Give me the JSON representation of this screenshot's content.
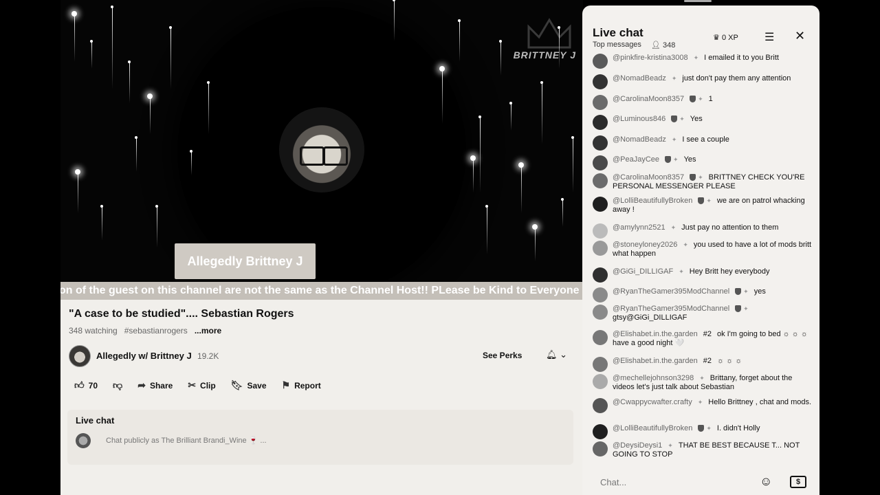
{
  "video": {
    "name_plate": "Allegedly Brittney J",
    "watermark": "BRITTNEY J",
    "ticker": "on of the guest on this channel are not the same as the Channel Host!! PLease be Kind to Everyone"
  },
  "details": {
    "title": "\"A case to be studied\"....  Sebastian Rogers",
    "watching": "348 watching",
    "hashtag": "#sebastianrogers",
    "more": "...more",
    "channel_name": "Allegedly w/ Brittney J",
    "subscribers": "19.2K",
    "see_perks": "See Perks",
    "bell_icon": "bell-icon",
    "actions": {
      "likes": "70",
      "share": "Share",
      "clip": "Clip",
      "save": "Save",
      "report": "Report"
    },
    "live_chat_panel": {
      "title": "Live chat",
      "input_placeholder": "Chat publicly as The Brilliant Brandi_Wine 🍷 ..."
    }
  },
  "chat": {
    "title": "Live chat",
    "subtitle": "Top messages",
    "viewers": "348",
    "xp": "0 XP",
    "input_placeholder": "Chat...",
    "messages": [
      {
        "author": "@pinkfire-kristina3008",
        "text": "I emailed it to you Britt",
        "badge": false
      },
      {
        "author": "@NomadBeadz",
        "text": "just don't pay them any attention",
        "badge": false
      },
      {
        "author": "@CarolinaMoon8357",
        "text": "1",
        "badge": true
      },
      {
        "author": "@Luminous846",
        "text": "Yes",
        "badge": true
      },
      {
        "author": "@NomadBeadz",
        "text": "I see a couple",
        "badge": false
      },
      {
        "author": "@PeaJayCee",
        "text": "Yes",
        "badge": true
      },
      {
        "author": "@CarolinaMoon8357",
        "text": "BRITTNEY CHECK YOU'RE PERSONAL MESSENGER PLEASE",
        "badge": true
      },
      {
        "author": "@LolliBeautifullyBroken",
        "text": "we are on patrol whacking away !",
        "badge": true
      },
      {
        "author": "@amylynn2521",
        "text": "Just pay no attention to them",
        "badge": false
      },
      {
        "author": "@stoneyloney2026",
        "text": "you used to have a lot of mods britt what happen",
        "badge": false
      },
      {
        "author": "@GiGi_DILLIGAF",
        "text": "Hey Britt hey everybody",
        "badge": false
      },
      {
        "author": "@RyanTheGamer395ModChannel",
        "text": "yes",
        "badge": true
      },
      {
        "author": "@RyanTheGamer395ModChannel",
        "text": "gtsy@GiGi_DILLIGAF",
        "badge": true
      },
      {
        "author": "@Elishabet.in.the.garden",
        "text": "ok I'm going to bed ☼ ☼ ☼ have a good night 🤍",
        "badge": false,
        "rank": "#2"
      },
      {
        "author": "@Elishabet.in.the.garden",
        "text": "☼ ☼ ☼",
        "badge": false,
        "rank": "#2"
      },
      {
        "author": "@mechellejohnson3298",
        "text": "Brittany, forget about the videos let's just talk about Sebastian",
        "badge": false
      },
      {
        "author": "@Cwappycwafter.crafty",
        "text": "Hello Brittney , chat and mods.",
        "badge": false
      },
      {
        "author": "@LolliBeautifullyBroken",
        "text": "I. didn't Holly",
        "badge": true
      },
      {
        "author": "@DeysiDeysi1",
        "text": "THAT BE BEST BECAUSE T... NOT GOING TO STOP",
        "badge": false
      }
    ]
  }
}
